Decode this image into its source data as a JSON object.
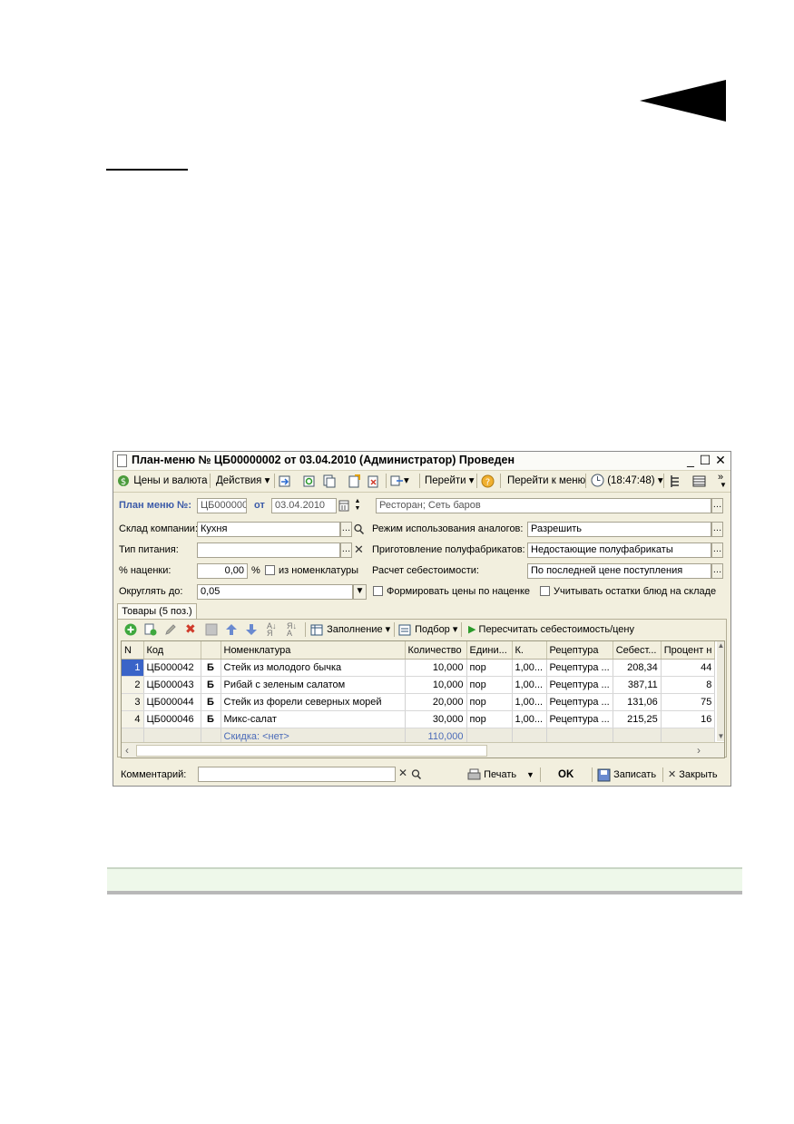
{
  "window": {
    "title": "План-меню № ЦБ00000002 от 03.04.2010 (Администратор) Проведен",
    "controls": [
      "_",
      "☐",
      "✕"
    ]
  },
  "toolbar": {
    "prices_label": "Цены и валюта",
    "actions_label": "Действия",
    "goto_label": "Перейти",
    "goto_menu_label": "Перейти к меню",
    "time_label": "(18:47:48)",
    "more": "»"
  },
  "header": {
    "number_label": "План меню №:",
    "number_value": "ЦБ000000",
    "date_label": "от",
    "date_value": "03.04.2010",
    "org_value": "Ресторан; Сеть баров"
  },
  "form": {
    "warehouse_label": "Склад компании:",
    "warehouse_value": "Кухня",
    "food_type_label": "Тип питания:",
    "food_type_value": "",
    "markup_label": "% наценки:",
    "markup_value": "0,00",
    "markup_unit": "%",
    "from_nomenclature_label": "из номенклатуры",
    "round_label": "Округлять до:",
    "round_value": "0,05",
    "analogs_label": "Режим использования аналогов:",
    "analogs_value": "Разрешить",
    "semi_label": "Приготовление полуфабрикатов:",
    "semi_value": "Недостающие полуфабрикаты",
    "cost_label": "Расчет себестоимости:",
    "cost_value": "По последней цене поступления",
    "form_prices_label": "Формировать цены по наценке",
    "account_rest_label": "Учитывать остатки блюд на складе"
  },
  "tab": {
    "label": "Товары (5 поз.)"
  },
  "grid_toolbar": {
    "fill_label": "Заполнение",
    "pick_label": "Подбор",
    "recalc_label": "Пересчитать себестоимость/цену"
  },
  "table": {
    "columns": [
      "N",
      "Код",
      "",
      "Номенклатура",
      "Количество",
      "Едини...",
      "К.",
      "Рецептура",
      "Себест...",
      "Процент н"
    ],
    "rows": [
      {
        "n": "1",
        "code": "ЦБ000042",
        "mark": "Б",
        "name": "Стейк из молодого бычка",
        "qty": "10,000",
        "unit": "пор",
        "k": "1,00...",
        "recipe": "Рецептура ...",
        "cost": "208,34",
        "pct": "44"
      },
      {
        "n": "2",
        "code": "ЦБ000043",
        "mark": "Б",
        "name": "Рибай с зеленым салатом",
        "qty": "10,000",
        "unit": "пор",
        "k": "1,00...",
        "recipe": "Рецептура ...",
        "cost": "387,11",
        "pct": "8"
      },
      {
        "n": "3",
        "code": "ЦБ000044",
        "mark": "Б",
        "name": "Стейк из форели северных морей",
        "qty": "20,000",
        "unit": "пор",
        "k": "1,00...",
        "recipe": "Рецептура ...",
        "cost": "131,06",
        "pct": "75"
      },
      {
        "n": "4",
        "code": "ЦБ000046",
        "mark": "Б",
        "name": "Микс-салат",
        "qty": "30,000",
        "unit": "пор",
        "k": "1,00...",
        "recipe": "Рецептура ...",
        "cost": "215,25",
        "pct": "16"
      }
    ],
    "footer": {
      "discount": "Скидка: <нет>",
      "qty_total": "110,000"
    }
  },
  "bottom": {
    "comment_label": "Комментарий:",
    "comment_value": "",
    "print_label": "Печать",
    "ok_label": "OK",
    "save_label": "Записать",
    "close_label": "Закрыть"
  },
  "colors": {
    "window_bg": "#f2efde",
    "selection": "#3a64c8",
    "header_label": "#3b5aa8",
    "hint_bar": "#eef8ea"
  }
}
